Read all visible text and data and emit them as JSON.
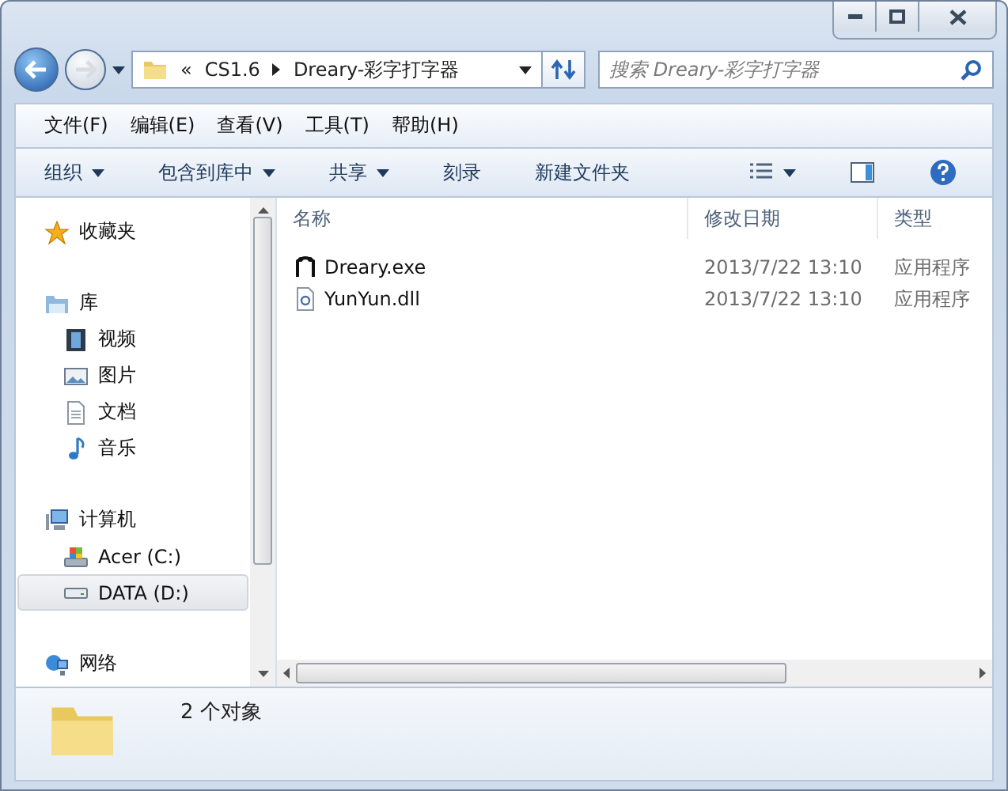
{
  "address": {
    "crumbs": [
      "«",
      "CS1.6",
      "Dreary-彩字打字器"
    ]
  },
  "search": {
    "placeholder": "搜索 Dreary-彩字打字器"
  },
  "menu": [
    "文件(F)",
    "编辑(E)",
    "查看(V)",
    "工具(T)",
    "帮助(H)"
  ],
  "toolbar": [
    {
      "label": "组织",
      "dropdown": true
    },
    {
      "label": "包含到库中",
      "dropdown": true
    },
    {
      "label": "共享",
      "dropdown": true
    },
    {
      "label": "刻录",
      "dropdown": false
    },
    {
      "label": "新建文件夹",
      "dropdown": false
    }
  ],
  "sidebar": [
    {
      "label": "收藏夹",
      "kind": "star",
      "selected": false
    },
    {
      "label": "库",
      "kind": "library",
      "selected": false,
      "children": [
        {
          "label": "视频",
          "kind": "video",
          "selected": false
        },
        {
          "label": "图片",
          "kind": "picture",
          "selected": false
        },
        {
          "label": "文档",
          "kind": "document",
          "selected": false
        },
        {
          "label": "音乐",
          "kind": "music",
          "selected": false
        }
      ]
    },
    {
      "label": "计算机",
      "kind": "computer",
      "selected": false,
      "children": [
        {
          "label": "Acer (C:)",
          "kind": "sysdrive",
          "selected": false
        },
        {
          "label": "DATA (D:)",
          "kind": "drive",
          "selected": true
        }
      ]
    },
    {
      "label": "网络",
      "kind": "network",
      "selected": false
    }
  ],
  "table": {
    "columns": [
      "名称",
      "修改日期",
      "类型"
    ],
    "rows": [
      {
        "name": "Dreary.exe",
        "kind": "exe",
        "date": "2013/7/22 13:10",
        "type": "应用程序"
      },
      {
        "name": "YunYun.dll",
        "kind": "dll",
        "date": "2013/7/22 13:10",
        "type": "应用程序"
      }
    ]
  },
  "status_bar": {
    "text": "2 个对象"
  }
}
